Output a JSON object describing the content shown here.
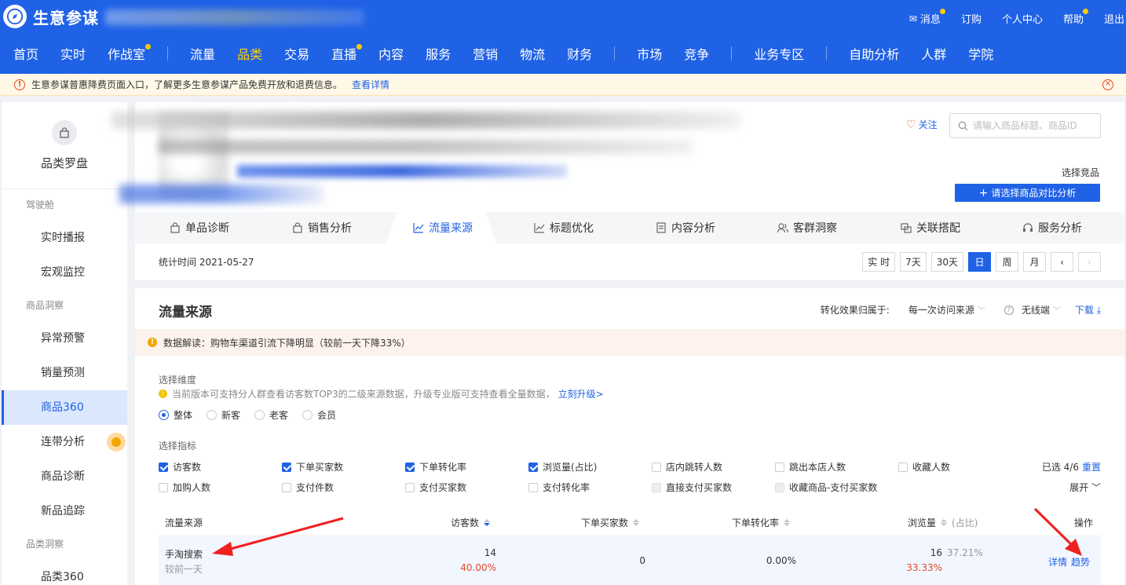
{
  "app": {
    "name": "生意参谋",
    "top_links": [
      {
        "label": "消息",
        "dot": true,
        "icon": "mail-icon"
      },
      {
        "label": "订购",
        "dot": false
      },
      {
        "label": "个人中心",
        "dot": false
      },
      {
        "label": "帮助",
        "dot": true
      },
      {
        "label": "退出",
        "dot": false
      }
    ],
    "nav": [
      "首页",
      "实时",
      "作战室",
      "流量",
      "品类",
      "交易",
      "直播",
      "内容",
      "服务",
      "营销",
      "物流",
      "财务",
      "市场",
      "竞争",
      "业务专区",
      "自助分析",
      "人群",
      "学院"
    ],
    "nav_active": "品类"
  },
  "notice": {
    "text": "生意参谋普惠降费页面入口，了解更多生意参谋产品免费开放和退费信息。",
    "link": "查看详情"
  },
  "sidebar": {
    "title": "品类罗盘",
    "groups": [
      {
        "label": "驾驶舱",
        "items": [
          "实时播报",
          "宏观监控"
        ]
      },
      {
        "label": "商品洞察",
        "items": [
          "异常预警",
          "销量预测",
          "商品360",
          "连带分析",
          "商品诊断",
          "新品追踪"
        ]
      },
      {
        "label": "品类洞察",
        "items": [
          "品类360"
        ]
      }
    ],
    "active": "商品360"
  },
  "product": {
    "follow": "关注",
    "search_placeholder": "请输入商品标题、商品ID",
    "compare_label": "选择竞品",
    "compare_button": "请选择商品对比分析",
    "tabs": [
      "单品诊断",
      "销售分析",
      "流量来源",
      "标题优化",
      "内容分析",
      "客群洞察",
      "关联搭配",
      "服务分析"
    ],
    "active_tab": "流量来源",
    "stat_time": "统计时间 2021-05-27",
    "periods": [
      "实 时",
      "7天",
      "30天",
      "日",
      "周",
      "月"
    ],
    "active_period": "日",
    "prev": "‹",
    "next": "›"
  },
  "traffic": {
    "title": "流量来源",
    "attr_label": "转化效果归属于:",
    "attr_value": "每一次访问来源",
    "device": "无线端",
    "download": "下载",
    "insight": "数据解读：购物车渠道引流下降明显（较前一天下降33%）",
    "dim_label": "选择维度",
    "tip": "当前版本可支持分人群查看访客数TOP3的二级来源数据，升级专业版可支持查看全量数据，",
    "tip_link": "立刻升级>",
    "segments": [
      "整体",
      "新客",
      "老客",
      "会员"
    ],
    "active_segment": "整体",
    "metric_label": "选择指标",
    "metrics_row1": [
      {
        "label": "访客数",
        "state": "on"
      },
      {
        "label": "下单买家数",
        "state": "on"
      },
      {
        "label": "下单转化率",
        "state": "on"
      },
      {
        "label": "浏览量(占比)",
        "state": "on"
      },
      {
        "label": "店内跳转人数",
        "state": "off"
      },
      {
        "label": "跳出本店人数",
        "state": "off"
      },
      {
        "label": "收藏人数",
        "state": "off"
      }
    ],
    "metrics_row2": [
      {
        "label": "加购人数",
        "state": "off"
      },
      {
        "label": "支付件数",
        "state": "off"
      },
      {
        "label": "支付买家数",
        "state": "off"
      },
      {
        "label": "支付转化率",
        "state": "off"
      },
      {
        "label": "直接支付买家数",
        "state": "disabled"
      },
      {
        "label": "收藏商品-支付买家数",
        "state": "disabled"
      }
    ],
    "selected": "已选 4/6",
    "reset": "重置",
    "expand": "展开",
    "columns": [
      "流量来源",
      "访客数",
      "下单买家数",
      "下单转化率",
      "浏览量",
      "(占比)",
      "操作"
    ],
    "rows": [
      {
        "source": "手淘搜索",
        "compare": "较前一天",
        "visitors": "14",
        "visitors_delta": "40.00%",
        "buyers": "0",
        "conv": "0.00%",
        "pv": "16",
        "pv_share": "37.21%",
        "pv_delta": "33.33%",
        "action_detail": "详情",
        "action_trend": "趋势"
      }
    ]
  },
  "colors": {
    "brand": "#2062e6",
    "active_nav": "#ffd400",
    "warn": "#e5482a",
    "annotation_arrow": "#f02020"
  }
}
